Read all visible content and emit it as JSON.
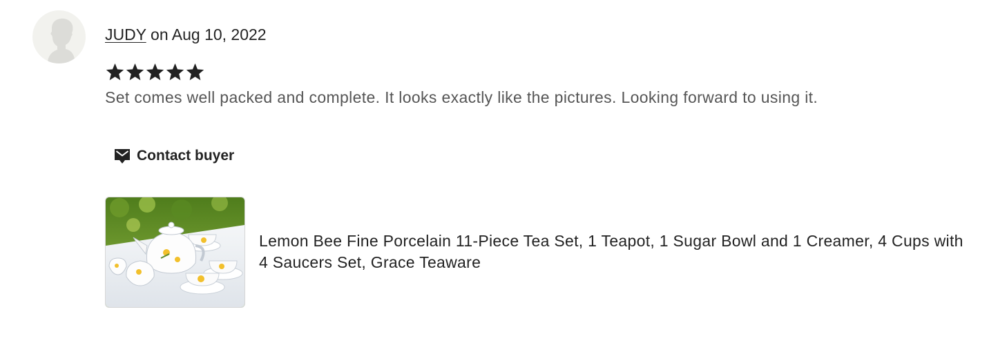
{
  "review": {
    "reviewer_name": "JUDY",
    "date_text": " on Aug 10, 2022",
    "rating": 5,
    "rating_max": 5,
    "text": "Set comes well packed and complete. It looks exactly like the pictures. Looking forward to using it."
  },
  "actions": {
    "contact_label": "Contact buyer",
    "contact_icon": "envelope-icon"
  },
  "listing": {
    "title": "Lemon Bee Fine Porcelain 11-Piece Tea Set, 1 Teapot, 1 Sugar Bowl and 1 Creamer, 4 Cups with 4 Saucers Set, Grace Teaware",
    "thumbnail": "tea-set-photo"
  },
  "colors": {
    "text_primary": "#222222",
    "text_secondary": "#555555",
    "avatar_bg": "#f2f2ee",
    "avatar_silhouette": "#dcdcd8"
  }
}
